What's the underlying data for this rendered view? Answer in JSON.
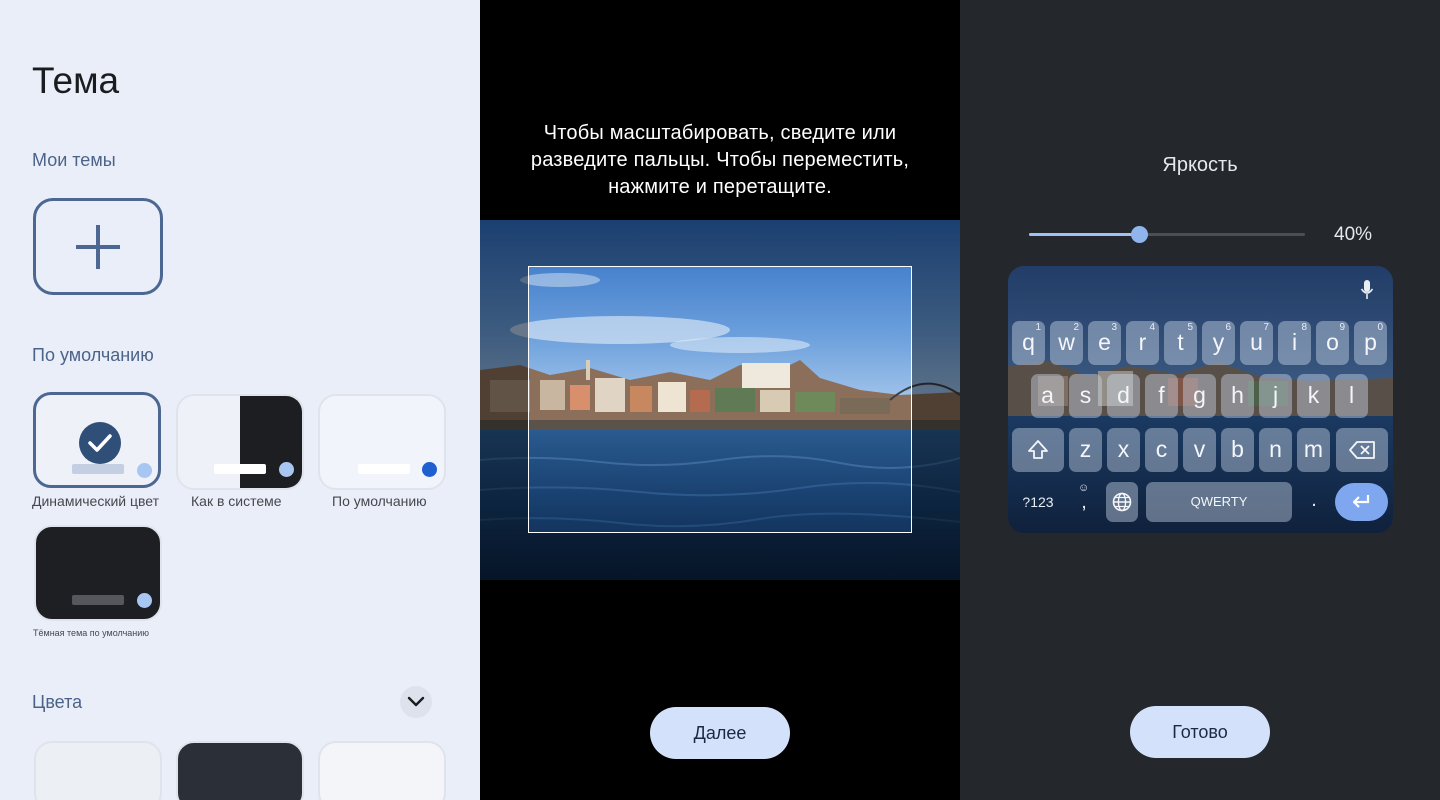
{
  "theme_panel": {
    "title": "Тема",
    "my_themes_label": "Мои темы",
    "default_label": "По умолчанию",
    "tiles": [
      {
        "caption": "Динамический цвет",
        "selected": true
      },
      {
        "caption": "Как в системе",
        "selected": false
      },
      {
        "caption": "По умолчанию",
        "selected": false
      },
      {
        "caption": "Тёмная тема по умолчанию",
        "selected": false
      }
    ],
    "colors_label": "Цвета"
  },
  "crop_panel": {
    "instruction_line1": "Чтобы масштабировать, сведите или",
    "instruction_line2": "разведите пальцы. Чтобы переместить,",
    "instruction_line3": "нажмите и перетащите.",
    "next_button": "Далее"
  },
  "brightness_panel": {
    "title": "Яркость",
    "brightness_percent": 40,
    "brightness_label": "40%",
    "done_button": "Готово",
    "keyboard": {
      "row1": [
        "q",
        "w",
        "e",
        "r",
        "t",
        "y",
        "u",
        "i",
        "o",
        "p"
      ],
      "row1_hints": [
        "1",
        "2",
        "3",
        "4",
        "5",
        "6",
        "7",
        "8",
        "9",
        "0"
      ],
      "row2": [
        "a",
        "s",
        "d",
        "f",
        "g",
        "h",
        "j",
        "k",
        "l"
      ],
      "row3": [
        "z",
        "x",
        "c",
        "v",
        "b",
        "n",
        "m"
      ],
      "symbols_key": "?123",
      "comma_key": ",",
      "space_key": "QWERTY",
      "period_key": "."
    }
  },
  "colors": {
    "theme_bg": "#eaeef8",
    "accent_blue": "#4c6791",
    "dark_panel_bg": "#24272c",
    "button_bg": "#d3e2fa"
  }
}
